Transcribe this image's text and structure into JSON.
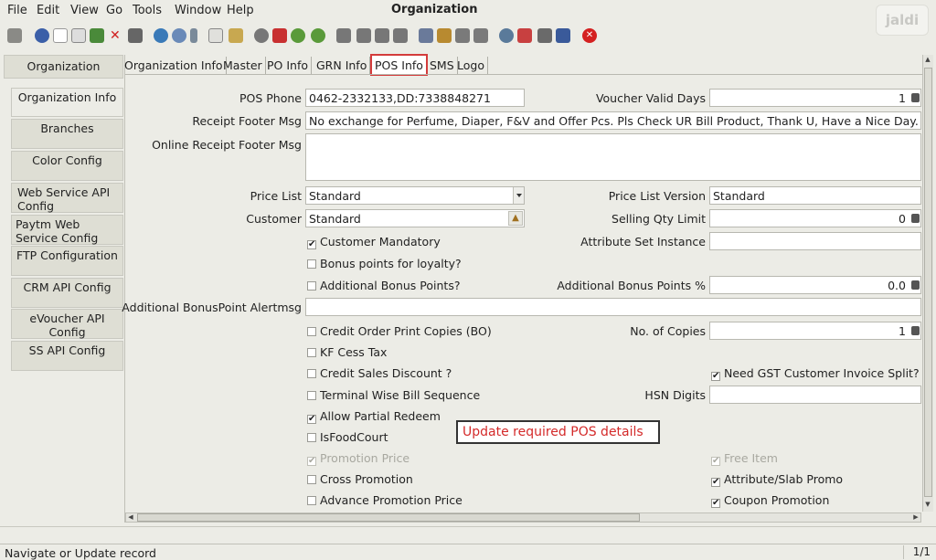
{
  "menu": {
    "items": [
      "File",
      "Edit",
      "View",
      "Go",
      "Tools",
      "Window",
      "Help"
    ],
    "window_title": "Organization",
    "brand": "jaldi"
  },
  "toolbar": {
    "icons": [
      "undo-icon",
      "help-icon",
      "new-icon",
      "copy-icon",
      "save-icon",
      "delete-icon",
      "print-icon",
      "refresh-icon",
      "find-icon",
      "attachment-icon",
      "chat-icon",
      "history-icon",
      "globe-icon",
      "home-icon",
      "back-icon",
      "forward-icon",
      "first-icon",
      "previous-icon",
      "next-icon",
      "last-icon",
      "report-icon",
      "archive-icon",
      "print-preview-icon",
      "print2-icon",
      "zoom-icon",
      "workflow-icon",
      "product-icon",
      "calculator-icon",
      "close-icon"
    ]
  },
  "leftnav": {
    "items": [
      {
        "label": "Organization"
      },
      {
        "label": "Organization Info"
      },
      {
        "label": "Branches"
      },
      {
        "label": "Color Config"
      },
      {
        "label": "Web Service API Config"
      },
      {
        "label": "Paytm Web Service Config"
      },
      {
        "label": "FTP Configuration"
      },
      {
        "label": "CRM API Config"
      },
      {
        "label": "eVoucher API Config"
      },
      {
        "label": "SS API Config"
      }
    ]
  },
  "tabs": [
    "Organization Info",
    "Master",
    "PO Info",
    "GRN Info",
    "POS Info",
    "SMS",
    "Logo"
  ],
  "active_tab": "POS Info",
  "form": {
    "pos_phone_label": "POS Phone",
    "pos_phone": "0462-2332133,DD:7338848271",
    "voucher_valid_days_label": "Voucher Valid Days",
    "voucher_valid_days": "1",
    "receipt_footer_label": "Receipt Footer Msg",
    "receipt_footer": "No exchange for Perfume, Diaper, F&V and Offer Pcs. Pls Check UR Bill Product, Thank U, Have a Nice Day.",
    "online_receipt_footer_label": "Online Receipt Footer Msg",
    "online_receipt_footer": "",
    "price_list_label": "Price List",
    "price_list": "Standard",
    "price_list_version_label": "Price List Version",
    "price_list_version": "Standard",
    "customer_label": "Customer",
    "customer": "Standard",
    "selling_qty_limit_label": "Selling Qty Limit",
    "selling_qty_limit": "0",
    "customer_mandatory": "Customer Mandatory",
    "attribute_set_instance_label": "Attribute Set Instance",
    "bonus_points": "Bonus points for loyalty?",
    "additional_bonus_points": "Additional Bonus Points?",
    "additional_bonus_points_pct_label": "Additional Bonus Points %",
    "additional_bonus_points_pct": "0.0",
    "additional_bonus_alert_label": "Additional BonusPoint Alertmsg",
    "credit_order_print": "Credit Order Print Copies (BO)",
    "no_of_copies_label": "No. of Copies",
    "no_of_copies": "1",
    "kf_cess_tax": "KF Cess Tax",
    "credit_sales_discount": "Credit Sales Discount ?",
    "need_gst_split": "Need GST Customer Invoice Split?",
    "terminal_wise_bill": "Terminal Wise Bill Sequence",
    "hsn_digits_label": "HSN Digits",
    "allow_partial_redeem": "Allow Partial Redeem",
    "is_food_court": "IsFoodCourt",
    "promotion_price": "Promotion Price",
    "free_item": "Free Item",
    "cross_promotion": "Cross Promotion",
    "attribute_slab_promo": "Attribute/Slab Promo",
    "advance_promotion_price": "Advance Promotion Price",
    "coupon_promotion": "Coupon Promotion"
  },
  "callout": "Update required POS details",
  "status": {
    "message": "Navigate or Update record",
    "page": "1/1"
  },
  "colors": {
    "accent_red": "#d43b3b",
    "background": "#ecece6"
  }
}
